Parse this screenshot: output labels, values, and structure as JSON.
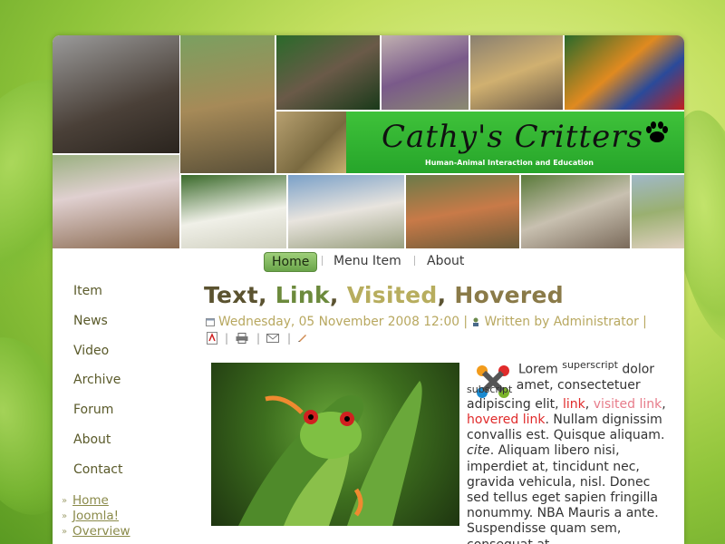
{
  "site": {
    "title": "Cathy's Critters",
    "subtitle": "Human-Animal Interaction and Education"
  },
  "topnav": {
    "items": [
      {
        "label": "Home",
        "active": true
      },
      {
        "label": "Menu Item",
        "active": false
      },
      {
        "label": "About",
        "active": false
      }
    ]
  },
  "sidenav": {
    "items": [
      "Item",
      "News",
      "Video",
      "Archive",
      "Forum",
      "About",
      "Contact"
    ]
  },
  "sublinks": [
    "Home",
    "Joomla!",
    "Overview"
  ],
  "article": {
    "heading": {
      "text": "Text",
      "link": "Link",
      "visited": "Visited",
      "hovered": "Hovered",
      "sep": ", "
    },
    "date": "Wednesday, 05 November 2008 12:00",
    "author": "Written by Administrator",
    "body": {
      "p1": "Lorem",
      "sup": "superscript",
      "p2": " dolor",
      "sub": "subscript",
      "p3": " amet, consectetuer adipiscing elit, ",
      "link": "link",
      "visited": "visited link",
      "hovered": "hovered link",
      "p4": ". Nullam dignissim convallis est. Quisque aliquam. ",
      "cite": "cite",
      "p5": ". Aliquam libero nisi, imperdiet at, tincidunt nec, gravida vehicula, nisl. Donec sed tellus eget sapien fringilla nonummy. NBA Mauris a ante. Suspendisse quam sem, consequat at,"
    }
  },
  "colors": {
    "heading_text": "#5b5330",
    "heading_link": "#6c8a3c",
    "heading_visited": "#b7ad5e",
    "heading_hovered": "#8a7a48",
    "link": "#e02b2b",
    "visited": "#e77c8a"
  },
  "icons": [
    "calendar-icon",
    "author-icon",
    "pdf-icon",
    "print-icon",
    "email-icon",
    "edit-icon",
    "paw-icon",
    "joomla-logo"
  ]
}
